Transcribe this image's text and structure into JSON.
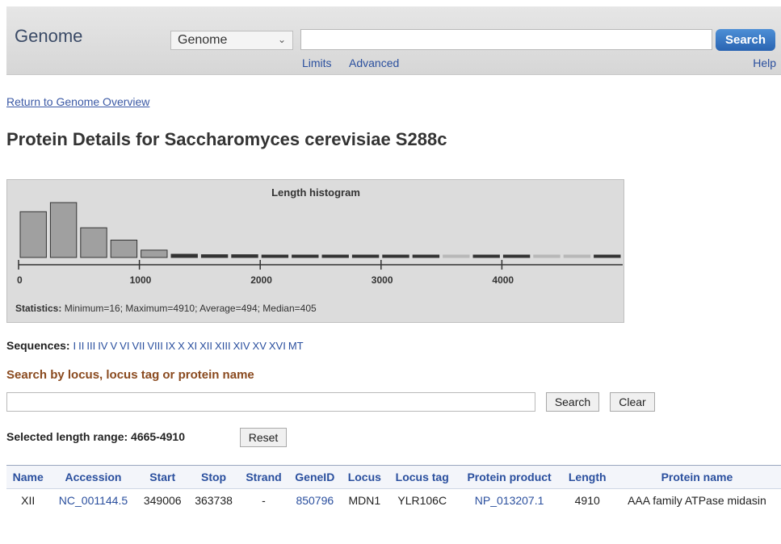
{
  "header": {
    "title": "Genome",
    "db_select": "Genome",
    "search_button": "Search",
    "links": {
      "limits": "Limits",
      "advanced": "Advanced",
      "help": "Help"
    }
  },
  "nav": {
    "return_link": "Return to Genome Overview"
  },
  "page": {
    "title": "Protein Details for Saccharomyces cerevisiae S288c"
  },
  "histogram": {
    "title": "Length histogram",
    "stats_label": "Statistics:",
    "stats": "Minimum=16; Maximum=4910; Average=494; Median=405",
    "ticks": [
      "0",
      "1000",
      "2000",
      "3000",
      "4000"
    ]
  },
  "chart_data": {
    "type": "bar",
    "title": "Length histogram",
    "bin_width": 250,
    "categories": [
      "0-250",
      "250-500",
      "500-750",
      "750-1000",
      "1000-1250",
      "1250-1500",
      "1500-1750",
      "1750-2000",
      "2000-2250",
      "2250-2500",
      "2500-2750",
      "2750-3000",
      "3000-3250",
      "3250-3500",
      "3500-3750",
      "3750-4000",
      "4000-4250",
      "4250-4500",
      "4500-4750",
      "4750-5000"
    ],
    "values": [
      1,
      1.2,
      0.65,
      0.38,
      0.16,
      0.07,
      0.06,
      0.06,
      0.05,
      0.05,
      0.05,
      0.05,
      0.05,
      0.05,
      0.03,
      0.05,
      0.05,
      0.03,
      0.03,
      0.05
    ],
    "dim_bins": [
      14,
      17,
      18
    ],
    "xlim": [
      0,
      5000
    ],
    "xticks": [
      0,
      1000,
      2000,
      3000,
      4000
    ]
  },
  "sequences": {
    "label": "Sequences:",
    "items": [
      "I",
      "II",
      "III",
      "IV",
      "V",
      "VI",
      "VII",
      "VIII",
      "IX",
      "X",
      "XI",
      "XII",
      "XIII",
      "XIV",
      "XV",
      "XVI",
      "MT"
    ]
  },
  "search": {
    "title": "Search by locus, locus tag or protein name",
    "search_button": "Search",
    "clear_button": "Clear"
  },
  "range": {
    "label": "Selected length range: 4665-4910",
    "reset_button": "Reset"
  },
  "table": {
    "headers": [
      "Name",
      "Accession",
      "Start",
      "Stop",
      "Strand",
      "GeneID",
      "Locus",
      "Locus tag",
      "Protein product",
      "Length",
      "Protein name"
    ],
    "rows": [
      [
        "XII",
        "NC_001144.5",
        "349006",
        "363738",
        "-",
        "850796",
        "MDN1",
        "YLR106C",
        "NP_013207.1",
        "4910",
        "AAA family ATPase midasin"
      ]
    ]
  }
}
